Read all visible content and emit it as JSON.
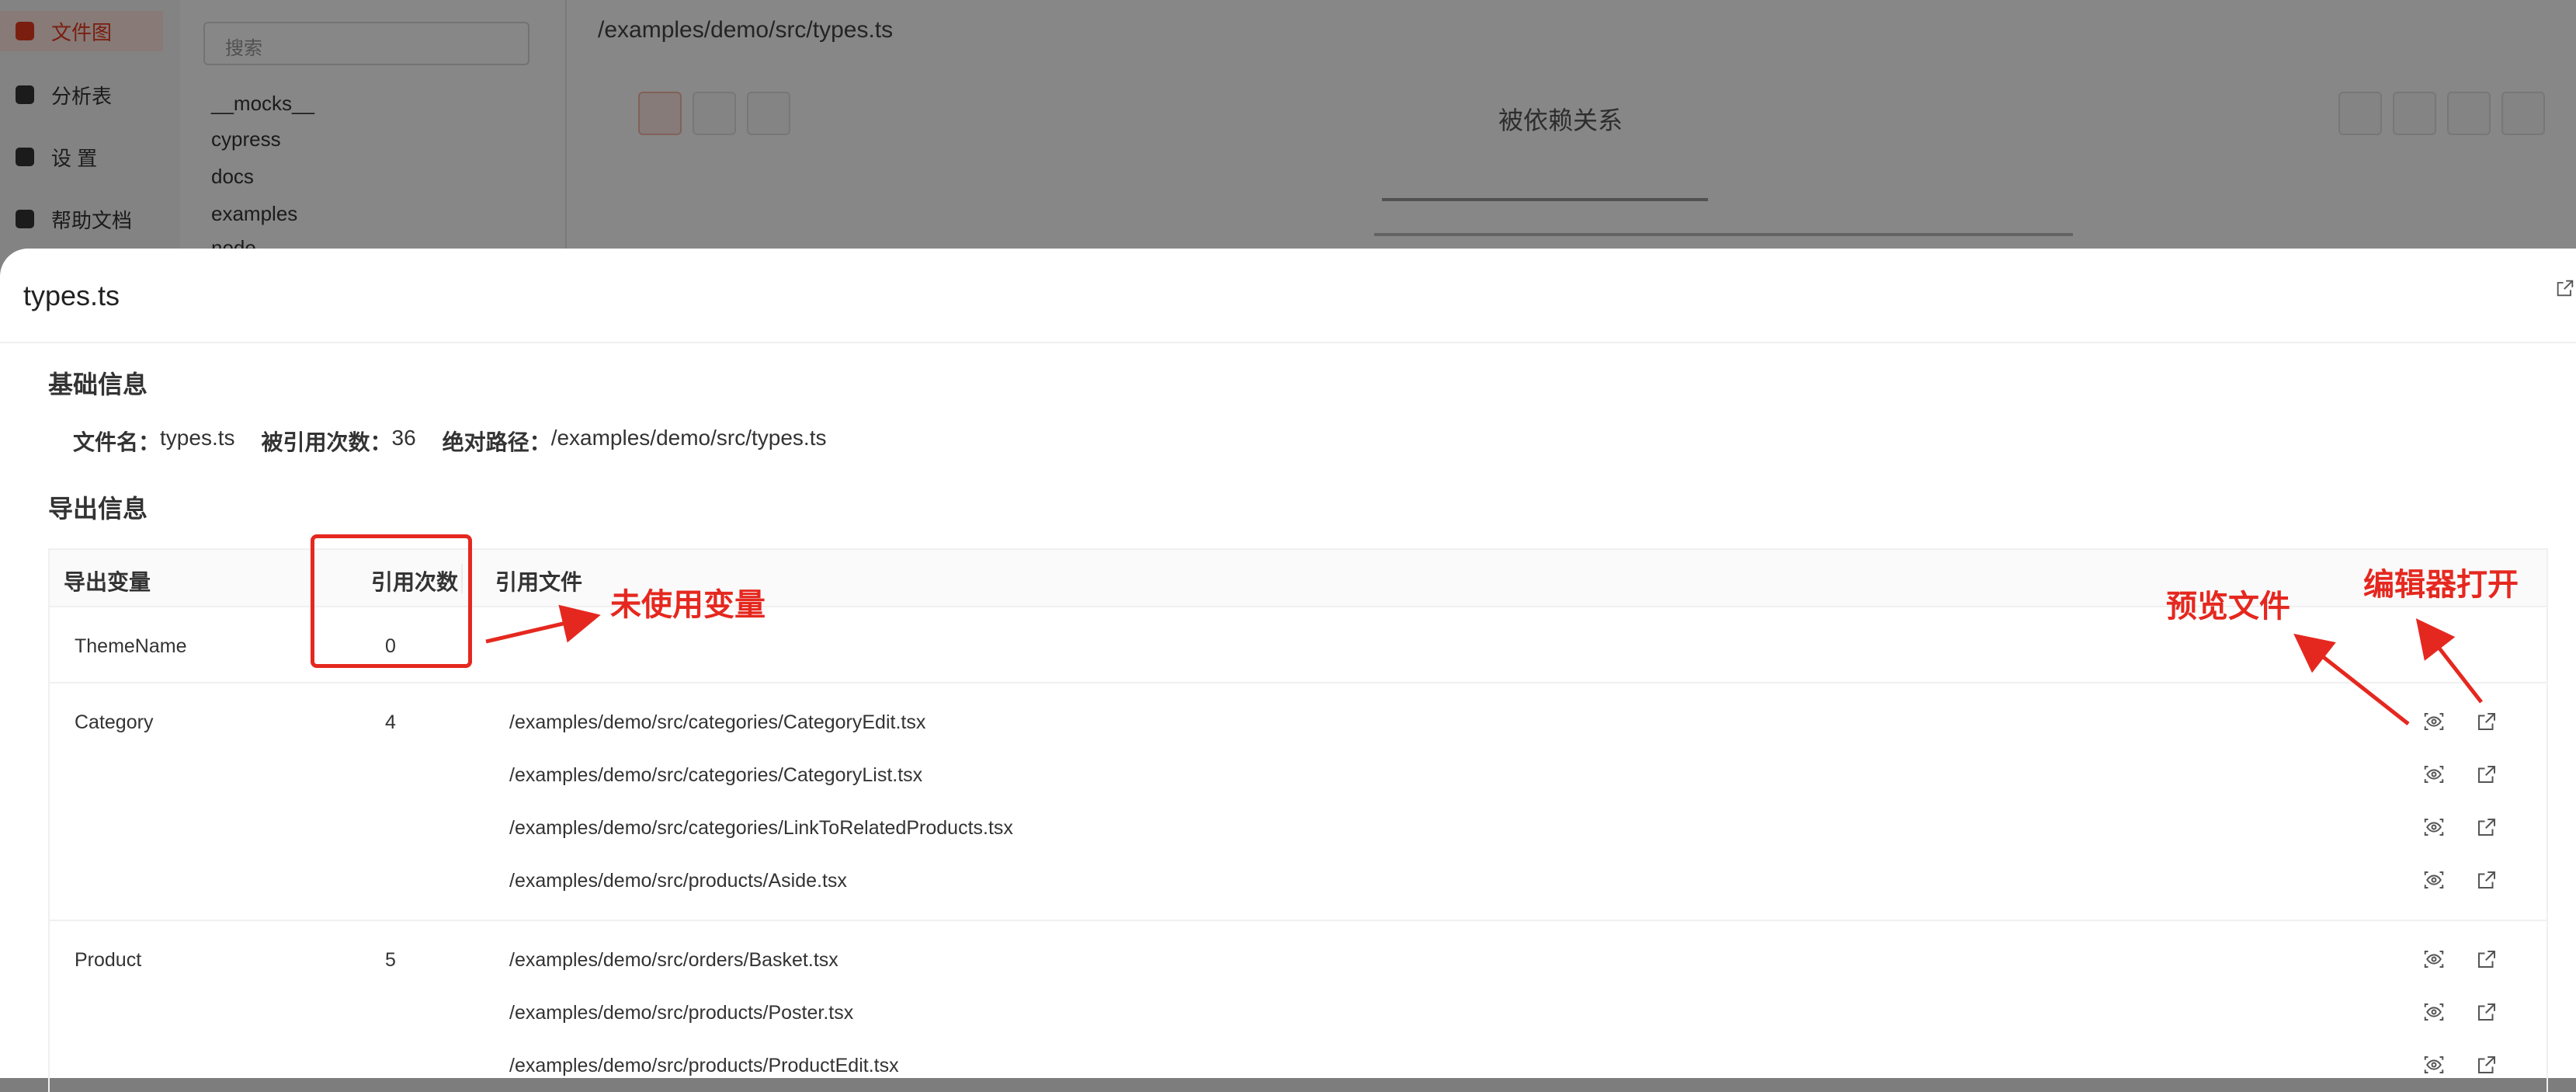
{
  "background": {
    "nav": [
      {
        "label": "文件图",
        "active": true
      },
      {
        "label": "分析表",
        "active": false
      },
      {
        "label": "设 置",
        "active": false
      },
      {
        "label": "帮助文档",
        "active": false
      }
    ],
    "search_placeholder": "搜索",
    "tree": [
      "__mocks__",
      "cypress",
      "docs",
      "examples",
      "node"
    ],
    "path": "/examples/demo/src/types.ts",
    "center_label": "被依赖关系"
  },
  "drawer": {
    "title": "types.ts",
    "basic_section": "基础信息",
    "info": {
      "filename_label": "文件名：",
      "filename": "types.ts",
      "refcount_label": "被引用次数：",
      "refcount": "36",
      "abspath_label": "绝对路径：",
      "abspath": "/examples/demo/src/types.ts"
    },
    "export_section": "导出信息",
    "table": {
      "headers": [
        "导出变量",
        "引用次数",
        "引用文件"
      ],
      "rows": [
        {
          "name": "ThemeName",
          "count": "0",
          "files": []
        },
        {
          "name": "Category",
          "count": "4",
          "files": [
            "/examples/demo/src/categories/CategoryEdit.tsx",
            "/examples/demo/src/categories/CategoryList.tsx",
            "/examples/demo/src/categories/LinkToRelatedProducts.tsx",
            "/examples/demo/src/products/Aside.tsx"
          ]
        },
        {
          "name": "Product",
          "count": "5",
          "files": [
            "/examples/demo/src/orders/Basket.tsx",
            "/examples/demo/src/products/Poster.tsx",
            "/examples/demo/src/products/ProductEdit.tsx"
          ]
        }
      ]
    }
  },
  "annotations": {
    "unused": "未使用变量",
    "preview": "预览文件",
    "open_editor": "编辑器打开",
    "color": "#e5281f"
  },
  "icons": {
    "preview": "eye-icon",
    "open": "external-link-icon"
  }
}
